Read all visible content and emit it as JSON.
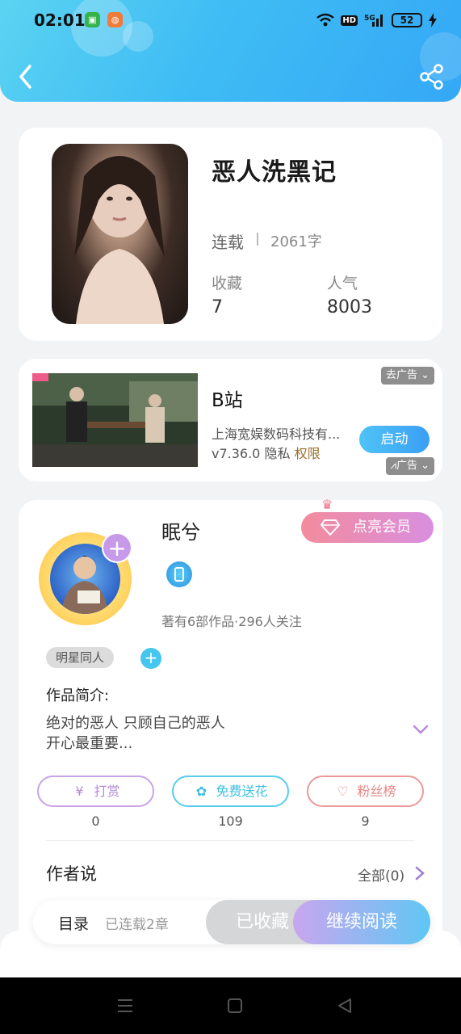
{
  "status_bar": {
    "time": "02:01",
    "network_label": "HD",
    "signal_label": "5G",
    "battery": "52"
  },
  "book": {
    "title": "恶人洗黑记",
    "status": "连载",
    "word_count": "2061字",
    "stats": [
      {
        "label": "收藏",
        "value": "7"
      },
      {
        "label": "人气",
        "value": "8003"
      }
    ]
  },
  "ad": {
    "title": "B站",
    "company": "上海宽娱数码科技有...",
    "version": "v7.36.0",
    "privacy": "隐私",
    "permission": "权限",
    "tag_top": "去广告",
    "tag_bottom": "广告",
    "launch_label": "启动"
  },
  "author": {
    "name": "眠兮",
    "vip_label": "点亮会员",
    "meta": "著有6部作品·296人关注",
    "tag": "明星同人",
    "intro_title": "作品简介:",
    "intro_line1": "绝对的恶人  只顾自己的恶人",
    "intro_line2": "开心最重要...",
    "actions": [
      {
        "label": "打赏",
        "count": "0",
        "color": "#c9a4e6"
      },
      {
        "label": "免费送花",
        "count": "109",
        "color": "#56cdea"
      },
      {
        "label": "粉丝榜",
        "count": "9",
        "color": "#eb9a9a"
      }
    ],
    "says_title": "作者说",
    "says_all": "全部(0)"
  },
  "bottom_bar": {
    "toc_label": "目录",
    "updated": "已连载2章",
    "favorited_label": "已收藏",
    "read_label": "继续阅读"
  },
  "colors": {
    "header_start": "#5bd3f2",
    "header_end": "#35a8f6",
    "accent_purple": "#c69ae8"
  }
}
